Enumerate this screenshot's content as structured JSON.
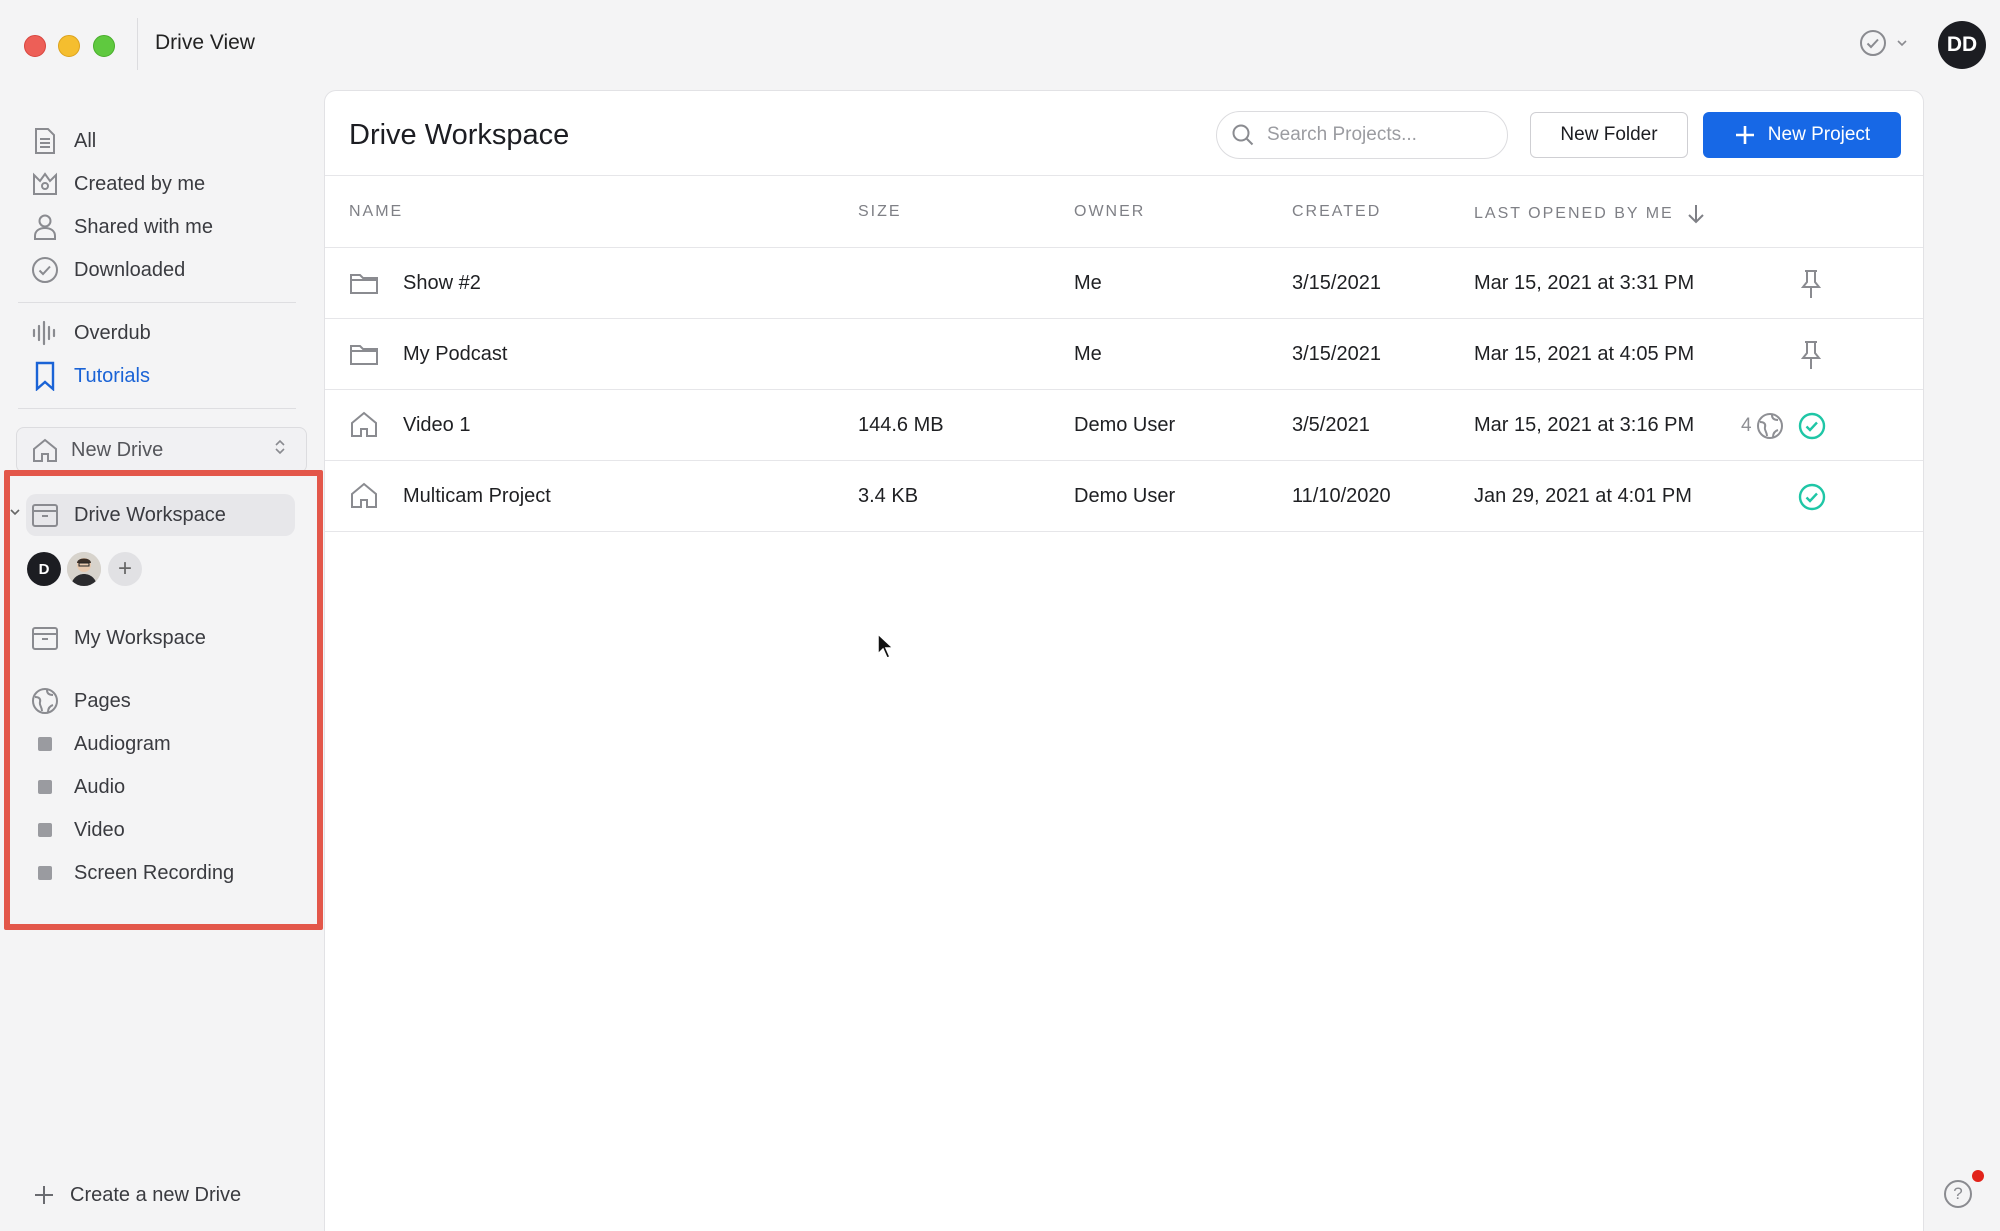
{
  "window": {
    "title": "Drive View",
    "user_initials": "DD"
  },
  "sidebar": {
    "filters": [
      {
        "label": "All",
        "icon": "document-icon"
      },
      {
        "label": "Created by me",
        "icon": "crown-icon"
      },
      {
        "label": "Shared with me",
        "icon": "person-icon"
      },
      {
        "label": "Downloaded",
        "icon": "check-circle-icon"
      }
    ],
    "features": [
      {
        "label": "Overdub",
        "icon": "waveform-icon"
      },
      {
        "label": "Tutorials",
        "icon": "bookmark-icon",
        "active": true
      }
    ],
    "drive_select": {
      "label": "New Drive"
    },
    "workspaces": [
      {
        "label": "Drive Workspace",
        "selected": true
      },
      {
        "label": "My Workspace"
      }
    ],
    "members": {
      "first_initial": "D"
    },
    "pages": {
      "label": "Pages",
      "items": [
        "Audiogram",
        "Audio",
        "Video",
        "Screen Recording"
      ]
    },
    "create_drive_label": "Create a new Drive"
  },
  "main": {
    "title": "Drive Workspace",
    "search_placeholder": "Search Projects...",
    "new_folder_label": "New Folder",
    "new_project_label": "New Project",
    "columns": [
      "NAME",
      "SIZE",
      "OWNER",
      "CREATED",
      "LAST OPENED BY ME"
    ],
    "rows": [
      {
        "type": "folder",
        "name": "Show #2",
        "size": "",
        "owner": "Me",
        "created": "3/15/2021",
        "last_opened": "Mar 15, 2021 at 3:31 PM",
        "pinned": true
      },
      {
        "type": "folder",
        "name": "My Podcast",
        "size": "",
        "owner": "Me",
        "created": "3/15/2021",
        "last_opened": "Mar 15, 2021 at 4:05 PM",
        "pinned": true
      },
      {
        "type": "project",
        "name": "Video 1",
        "size": "144.6 MB",
        "owner": "Demo User",
        "created": "3/5/2021",
        "last_opened": "Mar 15, 2021 at 3:16 PM",
        "shared_count": "4",
        "synced": true
      },
      {
        "type": "project",
        "name": "Multicam Project",
        "size": "3.4 KB",
        "owner": "Demo User",
        "created": "11/10/2020",
        "last_opened": "Jan 29, 2021 at 4:01 PM",
        "synced": true
      }
    ]
  },
  "colors": {
    "accent": "#1768e6",
    "highlight_border": "#e3574a",
    "sync_ok": "#1fc6a6"
  }
}
